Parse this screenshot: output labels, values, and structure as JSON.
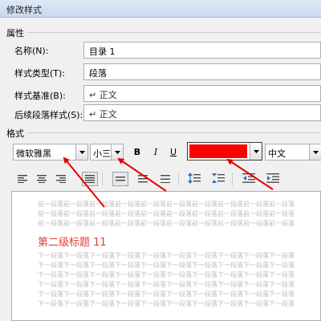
{
  "dialog": {
    "title": "修改样式"
  },
  "properties": {
    "section_label": "属性",
    "fields": [
      {
        "label": "名称(N):",
        "value": "目录 1",
        "has_dropdown": false
      },
      {
        "label": "样式类型(T):",
        "value": "段落",
        "has_dropdown": true
      },
      {
        "label": "样式基准(B):",
        "value": "↵ 正文",
        "has_dropdown": true
      },
      {
        "label": "后续段落样式(S):",
        "value": "↵ 正文",
        "has_dropdown": true
      }
    ]
  },
  "format": {
    "section_label": "格式",
    "font_name": "微软雅黑",
    "font_size": "小三",
    "bold_label": "B",
    "italic_label": "I",
    "underline_label": "U",
    "font_color": "#ff0000",
    "language": "中文"
  },
  "preview": {
    "prev_lines": [
      "前一段落前一段落前一段落前一段落前一段落前一段落前一段落前一段落前一段落前一段落",
      "前一段落前一段落前一段落前一段落前一段落前一段落前一段落前一段落前一段落前一段落",
      "前一段落前一段落前一段落前一段落前一段落前一段落前一段落前一段落前一段落前一段落"
    ],
    "heading_sample": "第二级标题 11",
    "next_lines": [
      "下一段落下一段落下一段落下一段落下一段落下一段落下一段落下一段落下一段落下一段落",
      "下一段落下一段落下一段落下一段落下一段落下一段落下一段落下一段落下一段落下一段落",
      "下一段落下一段落下一段落下一段落下一段落下一段落下一段落下一段落下一段落下一段落",
      "下一段落下一段落下一段落下一段落下一段落下一段落下一段落下一段落下一段落下一段落",
      "下一段落下一段落下一段落下一段落下一段落下一段落下一段落下一段落下一段落下一段落",
      "下一段落下一段落下一段落下一段落下一段落下一段落下一段落下一段落下一段落下一段落"
    ]
  },
  "colors": {
    "heading_color": "#e53b3b",
    "arrow_color": "#e60000",
    "titlebar": "#d6e3f3"
  }
}
